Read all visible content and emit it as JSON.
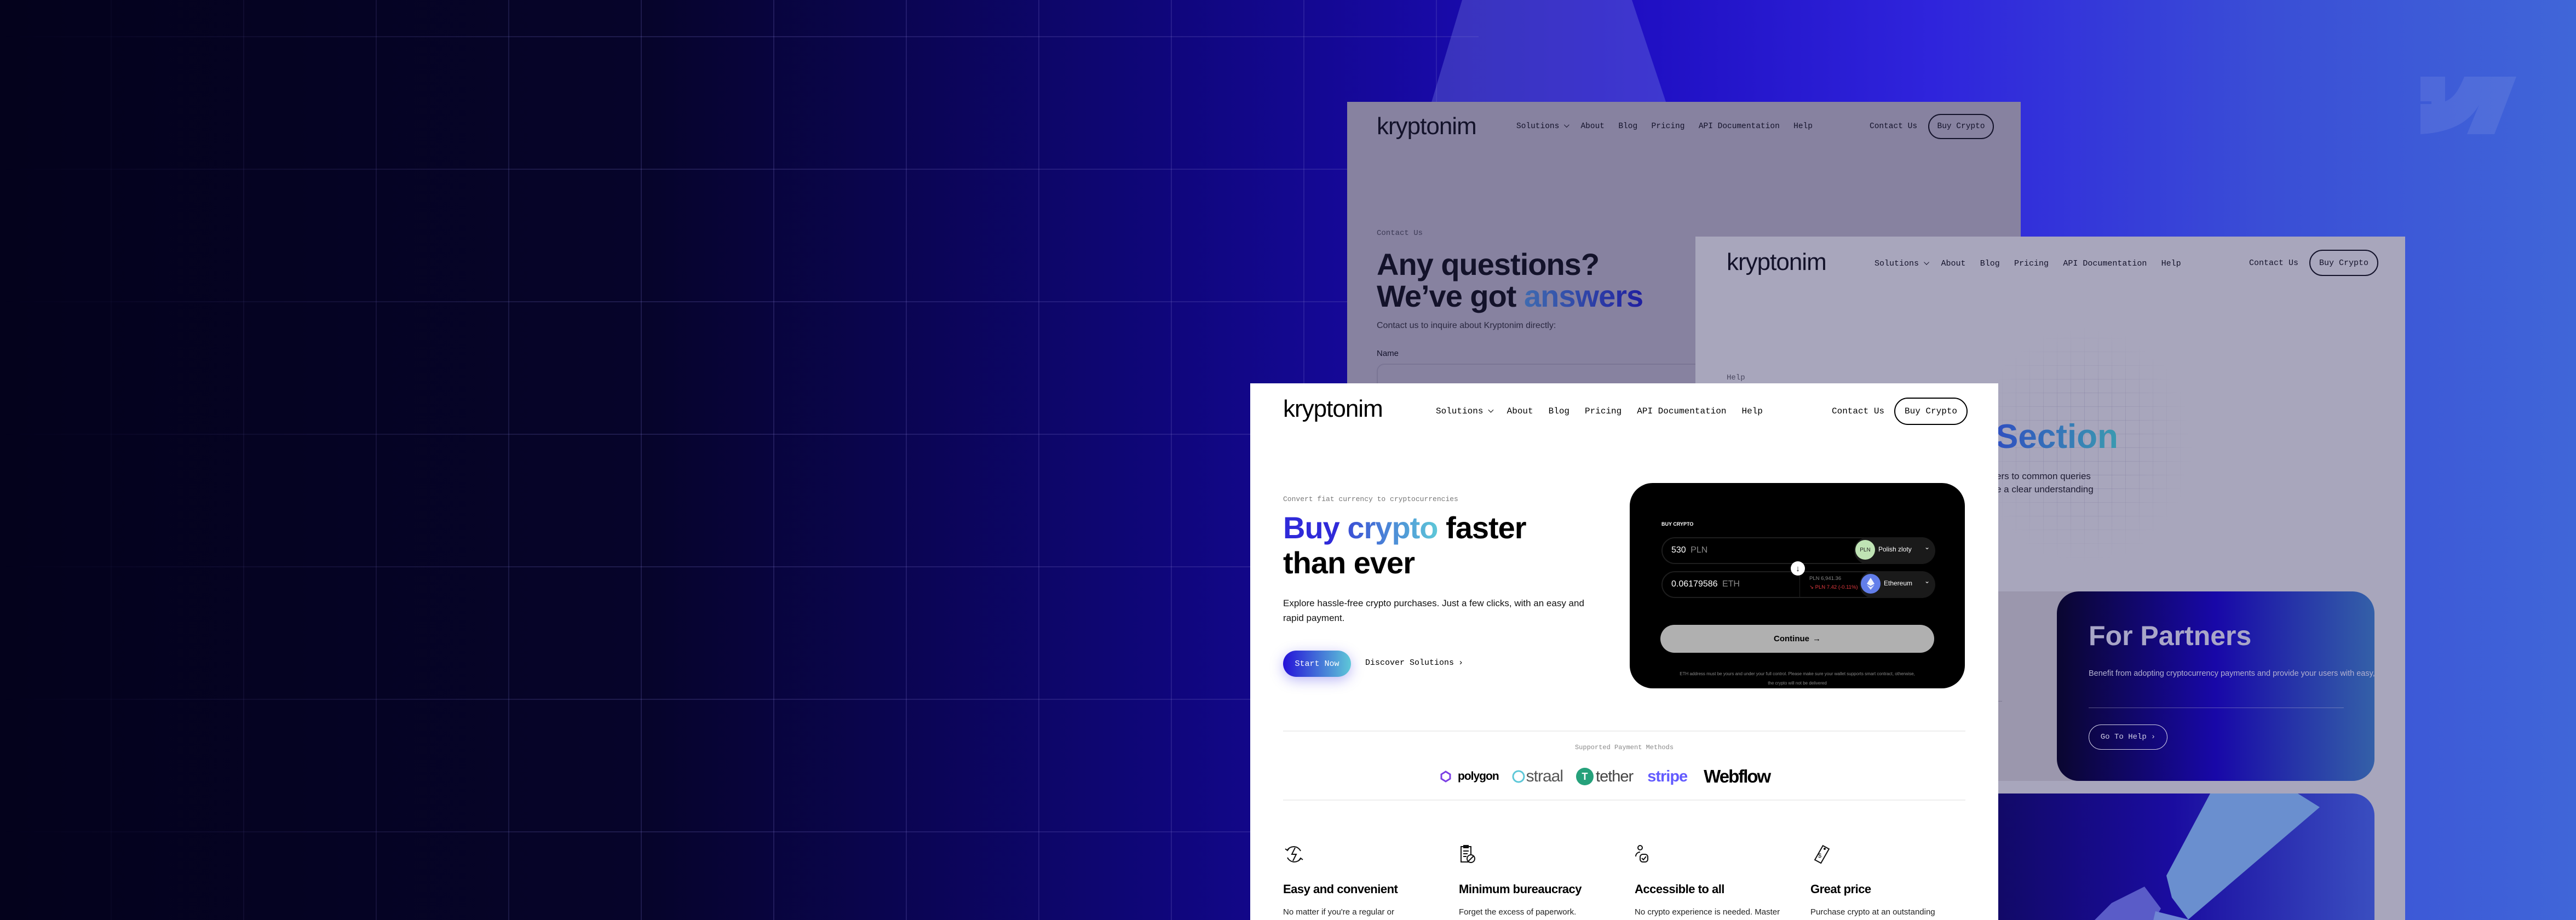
{
  "brand": {
    "logo": "kryptonim"
  },
  "nav": {
    "items": [
      "Solutions",
      "About",
      "Blog",
      "Pricing",
      "API Documentation",
      "Help"
    ],
    "contact": "Contact Us",
    "buy": "Buy Crypto"
  },
  "contact_page": {
    "eyebrow": "Contact Us",
    "title_line1": "Any questions?",
    "title_line2_pre": "We’ve got ",
    "title_line2_accent": "answers",
    "description": "Contact us to inquire about Kryptonim directly:",
    "name_label": "Name"
  },
  "help_page": {
    "eyebrow": "Help",
    "title_visible": "Section",
    "desc_line1": "ers to common queries",
    "desc_line2": "e a clear understanding",
    "partners": {
      "title": "For Partners",
      "description": "Benefit from adopting cryptocurrency payments and provide your users with easy, safe, and intuitive fiat-to-crypto exchange.",
      "button": "Go To Help"
    }
  },
  "hero": {
    "eyebrow": "Convert fiat currency to cryptocurrencies",
    "title_part1": "Buy ",
    "title_part2": "crypto",
    "title_part3": " faster",
    "title_line2": "than ever",
    "description": "Explore hassle-free crypto purchases. Just a few clicks, with an easy and rapid payment.",
    "start_button": "Start Now",
    "discover_button": "Discover Solutions"
  },
  "widget": {
    "label": "BUY CRYPTO",
    "from_amount": "530",
    "from_currency": "PLN",
    "from_badge": "PLN",
    "from_name": "Polish zloty",
    "to_amount": "0.06179586",
    "to_currency": "ETH",
    "to_name": "Ethereum",
    "rate": "PLN 6,941.36",
    "change": "PLN 7.42 (-0.11%)",
    "continue": "Continue",
    "note": "ETH address must be yours and under your full control. Please make sure your wallet supports smart contract, otherwise, the crypto will not be delivered"
  },
  "payments": {
    "title": "Supported Payment Methods",
    "logos": [
      "polygon",
      "straal",
      "tether",
      "stripe",
      "Webflow"
    ]
  },
  "features": [
    {
      "icon": "lightning-refresh-icon",
      "title": "Easy and convenient",
      "text": "No matter if you're a regular or"
    },
    {
      "icon": "clipboard-no-icon",
      "title": "Minimum bureaucracy",
      "text": "Forget the excess of paperwork."
    },
    {
      "icon": "person-check-icon",
      "title": "Accessible to all",
      "text": "No crypto experience is needed. Master"
    },
    {
      "icon": "price-tag-icon",
      "title": "Great price",
      "text": "Purchase crypto at an outstanding"
    }
  ],
  "colors": {
    "accent_blue": "#2f2ad9",
    "accent_cyan": "#5ec8d8",
    "change_red": "#e0393e",
    "pln_badge": "#bfe3b4",
    "eth_badge": "#627eea",
    "polygon": "#7b3fe4",
    "tether": "#26a17b",
    "stripe": "#635bff"
  }
}
